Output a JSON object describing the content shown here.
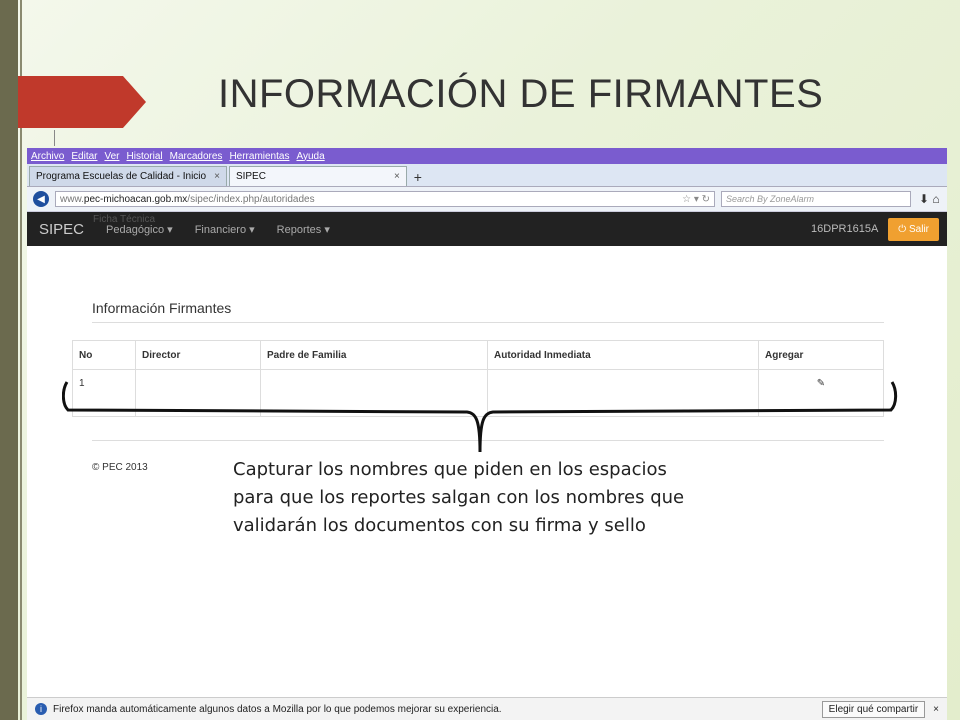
{
  "slide": {
    "title": "INFORMACIÓN DE FIRMANTES"
  },
  "browser": {
    "menu": [
      "Archivo",
      "Editar",
      "Ver",
      "Historial",
      "Marcadores",
      "Herramientas",
      "Ayuda"
    ],
    "tabs": [
      {
        "label": "Programa Escuelas de Calidad - Inicio",
        "close": "×"
      },
      {
        "label": "SIPEC",
        "close": "×"
      }
    ],
    "new_tab": "+",
    "url": {
      "prefix": "www.",
      "domain": "pec-michoacan.gob.mx",
      "path": "/sipec/index.php/autoridades"
    },
    "search_placeholder": "Search By ZoneAlarm"
  },
  "app": {
    "brand": "SIPEC",
    "ficha": "Ficha Técnica",
    "nav": [
      "Pedagógico ▾",
      "Financiero ▾",
      "Reportes ▾"
    ],
    "school_code": "16DPR1615A",
    "logout": "⏻ Salir",
    "heading": "Información Firmantes",
    "table": {
      "headers": [
        "No",
        "Director",
        "Padre de Familia",
        "Autoridad Inmediata",
        "Agregar"
      ],
      "rows": [
        {
          "no": "1",
          "director": "",
          "padre": "",
          "autoridad": "",
          "agregar": "✎"
        }
      ]
    },
    "footer": "© PEC 2013"
  },
  "statusbar": {
    "message": "Firefox manda automáticamente algunos datos a Mozilla por lo que podemos mejorar su experiencia.",
    "choose": "Elegir qué compartir",
    "close": "×"
  },
  "annotation": {
    "lines": [
      "Capturar los nombres que piden en los espacios",
      "para que los reportes salgan con los nombres que",
      "validarán los documentos con su firma y sello"
    ]
  }
}
